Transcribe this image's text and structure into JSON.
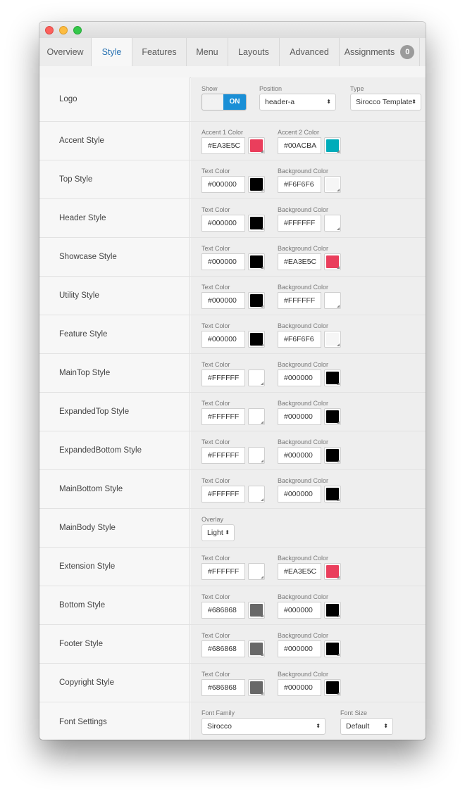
{
  "tabs": [
    {
      "label": "Overview",
      "active": false
    },
    {
      "label": "Style",
      "active": true
    },
    {
      "label": "Features",
      "active": false
    },
    {
      "label": "Menu",
      "active": false
    },
    {
      "label": "Layouts",
      "active": false
    },
    {
      "label": "Advanced",
      "active": false
    },
    {
      "label": "Assignments",
      "active": false,
      "badge": "0"
    }
  ],
  "logo": {
    "label": "Logo",
    "show_caption": "Show",
    "show_value": "ON",
    "position_caption": "Position",
    "position_value": "header-a",
    "type_caption": "Type",
    "type_value": "Sirocco Template"
  },
  "accent": {
    "label": "Accent Style",
    "c1_caption": "Accent 1 Color",
    "c1_value": "#EA3E5C",
    "c2_caption": "Accent 2 Color",
    "c2_value": "#00ACBA"
  },
  "styles": [
    {
      "label": "Top Style",
      "text": "#000000",
      "bg": "#F6F6F6"
    },
    {
      "label": "Header Style",
      "text": "#000000",
      "bg": "#FFFFFF"
    },
    {
      "label": "Showcase Style",
      "text": "#000000",
      "bg": "#EA3E5C"
    },
    {
      "label": "Utility Style",
      "text": "#000000",
      "bg": "#FFFFFF"
    },
    {
      "label": "Feature Style",
      "text": "#000000",
      "bg": "#F6F6F6"
    },
    {
      "label": "MainTop Style",
      "text": "#FFFFFF",
      "bg": "#000000"
    },
    {
      "label": "ExpandedTop Style",
      "text": "#FFFFFF",
      "bg": "#000000"
    },
    {
      "label": "ExpandedBottom Style",
      "text": "#FFFFFF",
      "bg": "#000000"
    },
    {
      "label": "MainBottom Style",
      "text": "#FFFFFF",
      "bg": "#000000"
    }
  ],
  "mainbody": {
    "label": "MainBody Style",
    "overlay_caption": "Overlay",
    "overlay_value": "Light"
  },
  "styles2": [
    {
      "label": "Extension Style",
      "text": "#FFFFFF",
      "bg": "#EA3E5C"
    },
    {
      "label": "Bottom Style",
      "text": "#686868",
      "bg": "#000000"
    },
    {
      "label": "Footer Style",
      "text": "#686868",
      "bg": "#000000"
    },
    {
      "label": "Copyright Style",
      "text": "#686868",
      "bg": "#000000"
    }
  ],
  "captions": {
    "text_color": "Text Color",
    "bg_color": "Background Color"
  },
  "font": {
    "label": "Font Settings",
    "family_caption": "Font Family",
    "family_value": "Sirocco",
    "size_caption": "Font Size",
    "size_value": "Default"
  },
  "colors": {
    "accent_blue": "#1a8fd6",
    "active_tab": "#2a73b3"
  }
}
